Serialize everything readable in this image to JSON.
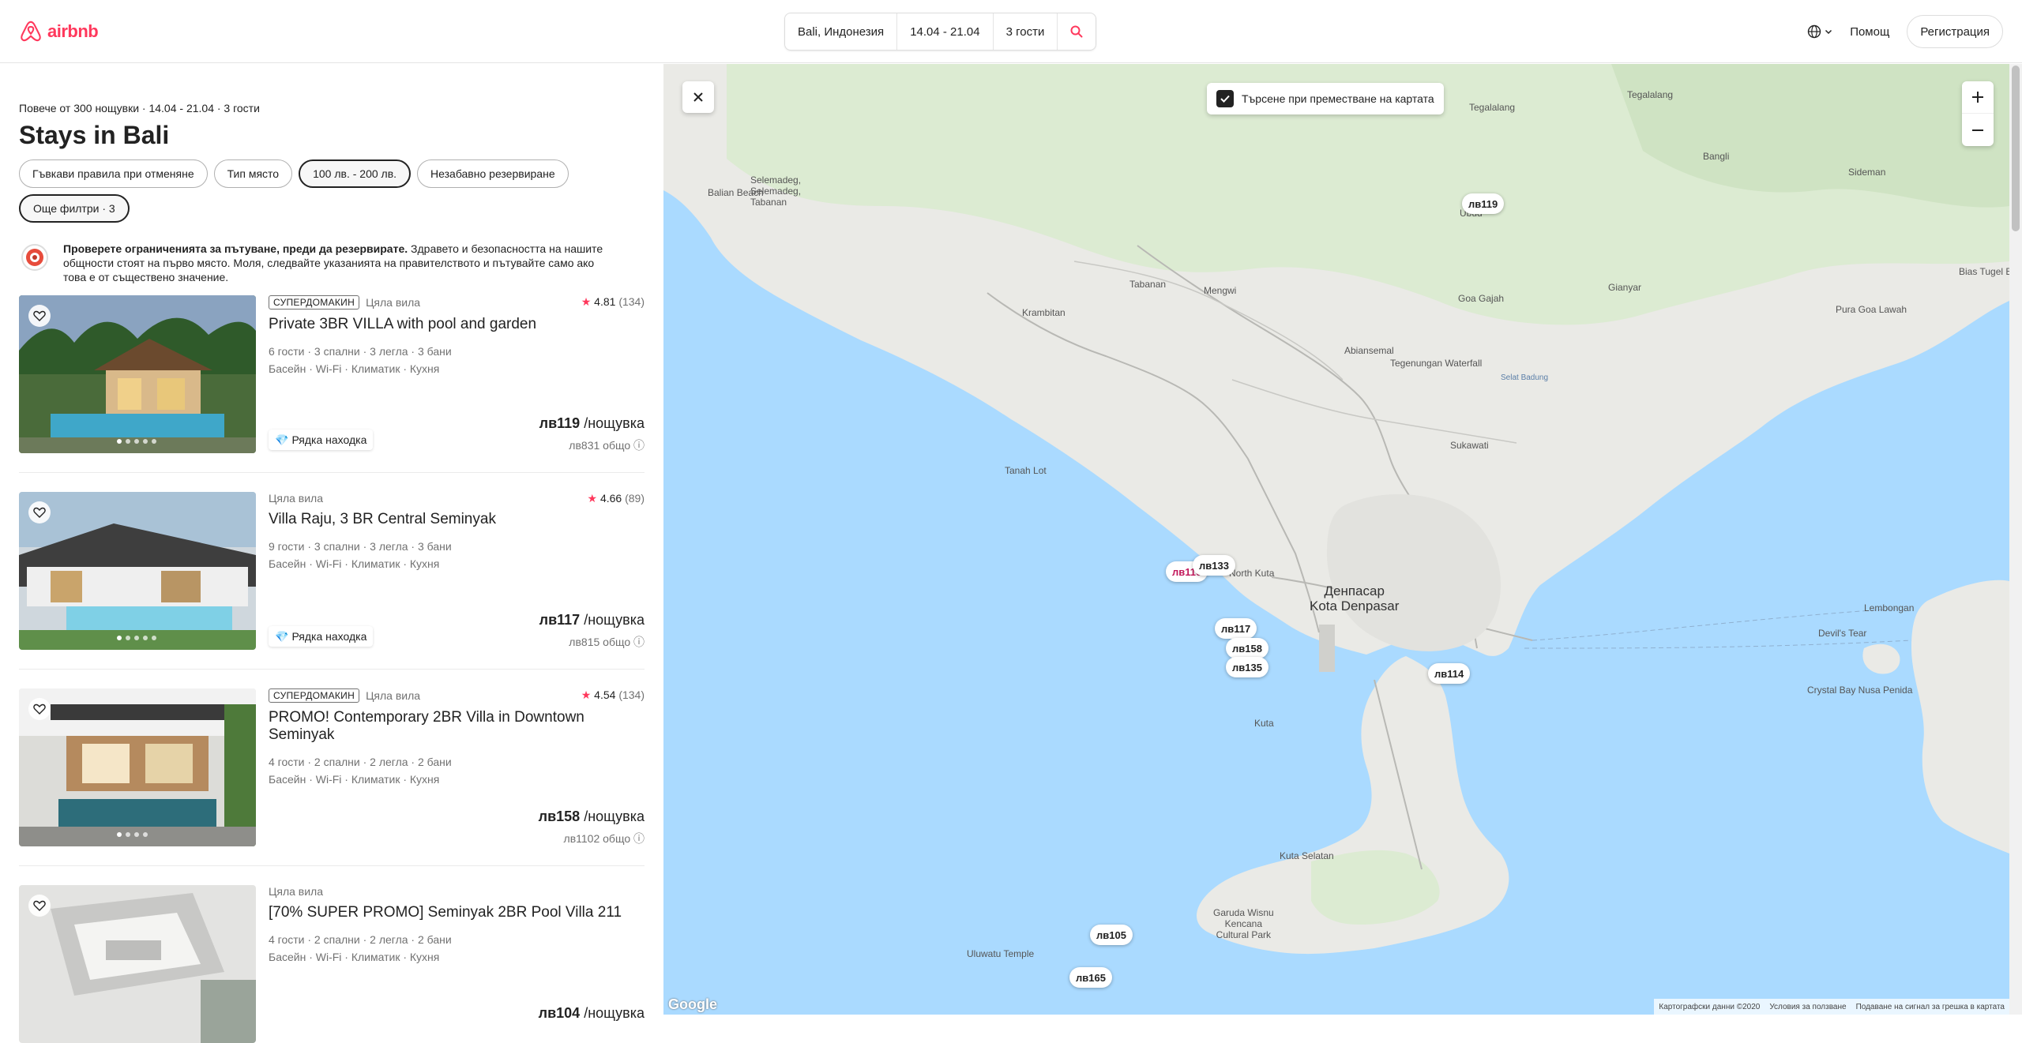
{
  "header": {
    "logo_text": "airbnb",
    "search": {
      "location": "Bali, Индонезия",
      "dates": "14.04 - 21.04",
      "guests": "3 гости"
    },
    "help": "Помощ",
    "register": "Регистрация"
  },
  "results": {
    "summary": "Повече от 300 нощувки · 14.04 - 21.04 · 3 гости",
    "title": "Stays in Bali",
    "filters": [
      {
        "label": "Гъвкави правила при отменяне",
        "active": false
      },
      {
        "label": "Тип място",
        "active": false
      },
      {
        "label": "100 лв. - 200 лв.",
        "active": true
      },
      {
        "label": "Незабавно резервиране",
        "active": false
      },
      {
        "label": "Още филтри · 3",
        "active": true
      }
    ],
    "notice_bold": "Проверете ограниченията за пътуване, преди да резервирате.",
    "notice_text": " Здравето и безопасността на нашите общности стоят на първо място. Моля, следвайте указанията на правителството и пътувайте само ако това е от съществено значение."
  },
  "listings": [
    {
      "badge": "СУПЕРДОМАКИН",
      "type": "Цяла вила",
      "rating": "4.81",
      "reviews": "(134)",
      "name": "Private 3BR VILLA with pool and garden",
      "details1": "6 гости · 3 спални · 3 легла · 3 бани",
      "details2": "Басейн · Wi-Fi · Климатик · Кухня",
      "price": "лв119",
      "per": " /нощувка",
      "total": "лв831 общо",
      "rare": "Рядка находка"
    },
    {
      "badge": "",
      "type": "Цяла вила",
      "rating": "4.66",
      "reviews": "(89)",
      "name": "Villa Raju, 3 BR Central Seminyak",
      "details1": "9 гости · 3 спални · 3 легла · 3 бани",
      "details2": "Басейн · Wi-Fi · Климатик · Кухня",
      "price": "лв117",
      "per": " /нощувка",
      "total": "лв815 общо",
      "rare": "Рядка находка"
    },
    {
      "badge": "СУПЕРДОМАКИН",
      "type": "Цяла вила",
      "rating": "4.54",
      "reviews": "(134)",
      "name": "PROMO! Contemporary 2BR Villa in Downtown Seminyak",
      "details1": "4 гости · 2 спални · 2 легла · 2 бани",
      "details2": "Басейн · Wi-Fi · Климатик · Кухня",
      "price": "лв158",
      "per": " /нощувка",
      "total": "лв1102 общо",
      "rare": ""
    },
    {
      "badge": "",
      "type": "Цяла вила",
      "rating": "",
      "reviews": "",
      "name": "[70% SUPER PROMO] Seminyak 2BR Pool Villa 211",
      "details1": "4 гости · 2 спални · 2 легла · 2 бани",
      "details2": "Басейн · Wi-Fi · Климатик · Кухня",
      "price": "лв104",
      "per": " /нощувка",
      "total": "",
      "rare": ""
    }
  ],
  "map": {
    "search_on_move": "Търсене при преместване на картата",
    "pins": [
      "лв119",
      "лв110",
      "лв133",
      "лв117",
      "лв158",
      "лв135",
      "лв114",
      "лв105",
      "лв165"
    ],
    "places": {
      "tegallalang": "Tegalalang",
      "bangli": "Bangli",
      "sideman": "Sideman",
      "balian_beach": "Balian Beach",
      "selemadeg": "Selemadeg,\nSelemadeg,\nTabanan",
      "ubud": "Ubud",
      "goa_gajah": "Goa Gajah",
      "tabanan": "Tabanan",
      "mengwi": "Mengwi",
      "krambitan": "Krambitan",
      "gianyar": "Gianyar",
      "pura_goa_lawah": "Pura Goa Lawah",
      "bias_tugel": "Bias Tugel Be",
      "abiansemal": "Abiansemal",
      "tegenungan": "Tegenungan Waterfall",
      "sukawati": "Sukawati",
      "tanah_lot": "Tanah Lot",
      "north_kuta": "North Kuta",
      "denpasar": "Денпасар\nKota Denpasar",
      "lembongan": "Lembongan",
      "devils_tear": "Devil's Tear",
      "crystal_bay": "Crystal Bay Nusa Penida",
      "kuta": "Kuta",
      "kuta_selatan": "Kuta Selatan",
      "gwk": "Garuda Wisnu\nKencana\nCultural Park",
      "uluwatu": "Uluwatu Temple",
      "strait": "Selat Badung"
    },
    "attribution": [
      "Картографски данни ©2020",
      "Условия за ползване",
      "Подаване на сигнал за грешка в картата"
    ],
    "google": "Google"
  }
}
